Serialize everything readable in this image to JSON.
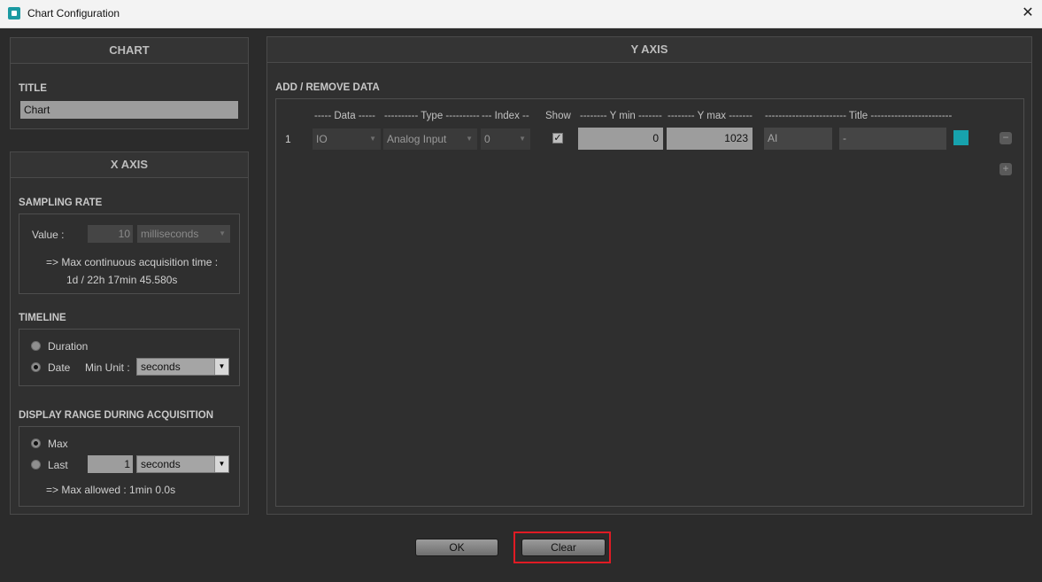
{
  "window": {
    "title": "Chart Configuration",
    "close_glyph": "✕"
  },
  "chart": {
    "header": "CHART",
    "title_label": "TITLE",
    "title_value": "Chart"
  },
  "x_axis": {
    "header": "X AXIS",
    "sampling": {
      "label": "SAMPLING RATE",
      "value_label": "Value :",
      "value": "10",
      "unit": "milliseconds",
      "max_time_line1": "=>  Max continuous acquisition time :",
      "max_time_line2": "1d  / 22h 17min 45.580s"
    },
    "timeline": {
      "label": "TIMELINE",
      "duration_label": "Duration",
      "date_label": "Date",
      "min_unit_label": "Min Unit :",
      "min_unit_value": "seconds",
      "selected": "Date"
    },
    "display_range": {
      "label": "DISPLAY RANGE DURING ACQUISITION",
      "max_label": "Max",
      "last_label": "Last",
      "last_value": "1",
      "last_unit": "seconds",
      "max_allowed": "=>  Max allowed : 1min 0.0s",
      "selected": "Max"
    }
  },
  "y_axis": {
    "header": "Y AXIS",
    "add_remove_label": "ADD / REMOVE DATA",
    "columns": {
      "data": "----- Data -----",
      "type": "---------- Type ----------",
      "index": "--- Index --",
      "show": "Show",
      "ymin": "-------- Y min -------",
      "ymax": "-------- Y max -------",
      "title": "------------------------ Title ------------------------"
    },
    "rows": [
      {
        "number": "1",
        "data": "IO",
        "type": "Analog Input",
        "index": "0",
        "show": true,
        "ymin": "0",
        "ymax": "1023",
        "title_short": "AI",
        "title_long": "-",
        "color": "#17a2ad"
      }
    ],
    "remove_glyph": "−",
    "add_glyph": "+"
  },
  "buttons": {
    "ok": "OK",
    "clear": "Clear"
  },
  "colors": {
    "highlight": "#e01b24",
    "series": "#17a2ad"
  },
  "icons": {
    "app": "app-icon",
    "close": "close-icon",
    "dropdown": "chevron-down-icon",
    "checkbox": "check-icon",
    "remove": "minus-icon",
    "add": "plus-icon"
  }
}
